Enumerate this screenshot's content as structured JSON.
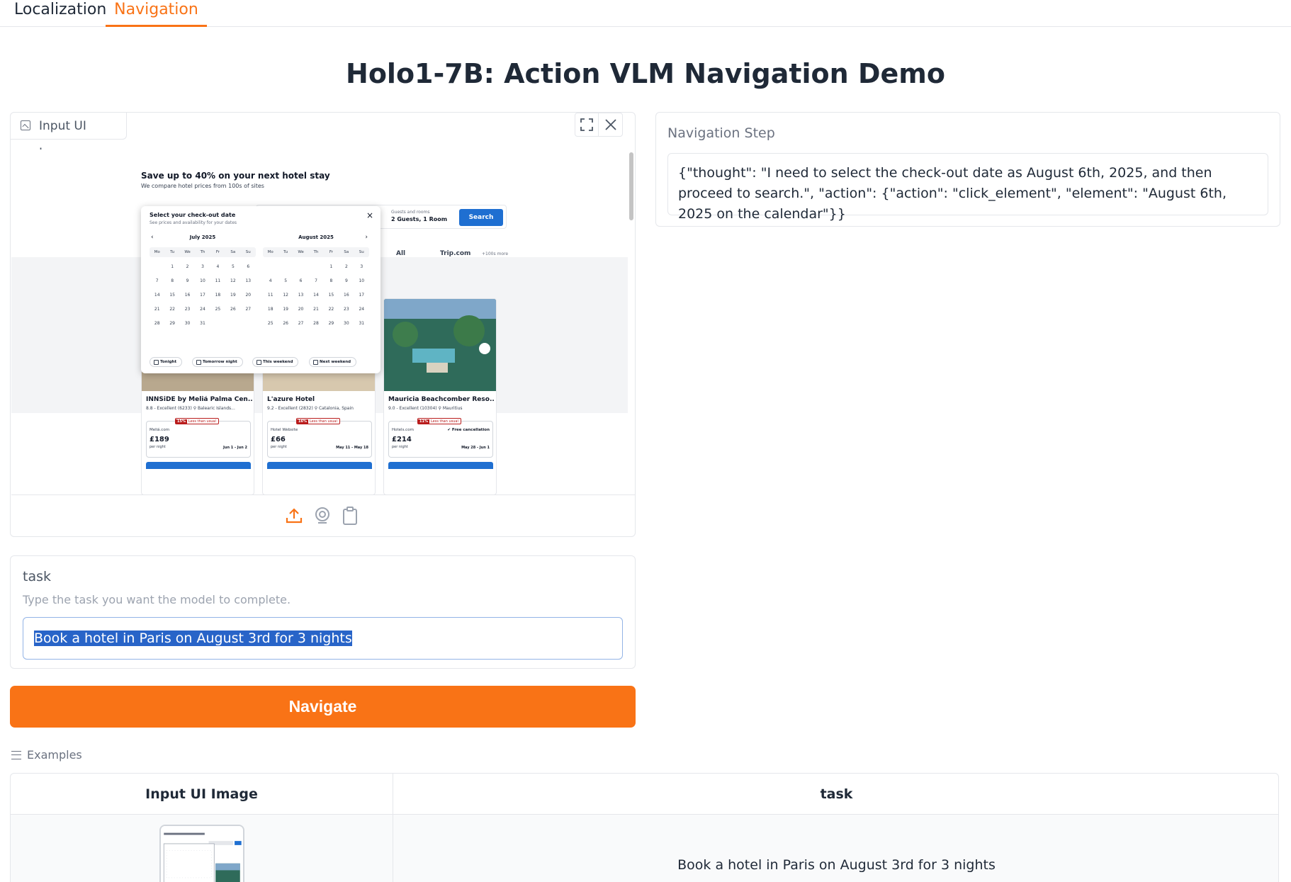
{
  "tabs": [
    {
      "label": "Localization",
      "active": false
    },
    {
      "label": "Navigation",
      "active": true
    }
  ],
  "page_title": "Holo1-7B: Action VLM Navigation Demo",
  "image_panel": {
    "label": "Input UI Image",
    "fullscreen_icon": "fullscreen-icon",
    "close_icon": "close-icon",
    "tools": [
      "upload-icon",
      "webcam-icon",
      "clipboard-icon"
    ],
    "accent": "#f97316"
  },
  "screenshot": {
    "promo_title": "Save up to 40% on your next hotel stay",
    "promo_sub": "We compare hotel prices from 100s of sites",
    "guests_label": "Guests and rooms",
    "guests_value": "2 Guests, 1 Room",
    "search_btn": "Search",
    "partners": [
      "All",
      "Trip.com"
    ],
    "partners_more": "+100s more",
    "popup": {
      "title": "Select your check-out date",
      "subtitle": "See prices and availability for your dates",
      "close": "×",
      "prev": "‹",
      "next": "›",
      "months": [
        {
          "name": "July 2025",
          "dows": [
            "Mo",
            "Tu",
            "We",
            "Th",
            "Fr",
            "Sa",
            "Su"
          ],
          "offset": 1,
          "days": 31
        },
        {
          "name": "August 2025",
          "dows": [
            "Mo",
            "Tu",
            "We",
            "Th",
            "Fr",
            "Sa",
            "Su"
          ],
          "offset": 4,
          "days": 31
        }
      ],
      "chips": [
        "Tonight",
        "Tomorrow night",
        "This weekend",
        "Next weekend"
      ]
    },
    "hotels": [
      {
        "name": "INNSiDE by Meliá Palma Cen...",
        "rating": "8.8 - Excellent (6233)  ⚲ Balearic Islands...",
        "badge_pct": "15%",
        "badge_text": "Less than usual",
        "site": "Meliá.com",
        "price": "£189",
        "per_night": "per night",
        "dates": "Jun 1 - Jun 2",
        "free": ""
      },
      {
        "name": "L'azure Hotel",
        "rating": "9.2 - Excellent (2832)  ⚲ Catalonia, Spain",
        "badge_pct": "16%",
        "badge_text": "Less than usual",
        "site": "Hotel Website",
        "price": "£66",
        "per_night": "per night",
        "dates": "May 11 - May 18",
        "free": ""
      },
      {
        "name": "Mauricia Beachcomber Reso...",
        "rating": "9.0 - Excellent (10304)  ⚲ Mauritius",
        "badge_pct": "11%",
        "badge_text": "Less than usual",
        "site": "Hotels.com",
        "price": "£214",
        "per_night": "per night",
        "dates": "May 28 - Jun 1",
        "free": "✔ Free cancellation"
      }
    ]
  },
  "task": {
    "label": "task",
    "info": "Type the task you want the model to complete.",
    "value": "Book a hotel in Paris on August 3rd for 3 nights"
  },
  "navigate_button": "Navigate",
  "examples": {
    "label": "Examples",
    "headers": [
      "Input UI Image",
      "task"
    ],
    "rows": [
      {
        "task": "Book a hotel in Paris on August 3rd for 3 nights"
      }
    ]
  },
  "output": {
    "label": "Navigation Step",
    "text": "{\"thought\": \"I need to select the check-out date as August 6th, 2025, and then proceed to search.\", \"action\": {\"action\": \"click_element\", \"element\": \"August 6th, 2025 on the calendar\"}}"
  }
}
